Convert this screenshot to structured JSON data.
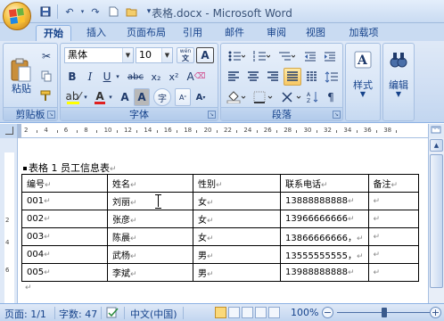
{
  "window": {
    "title": "表格.docx - Microsoft Word"
  },
  "quick_access": [
    {
      "name": "save-icon",
      "glyph": "▣"
    },
    {
      "name": "undo-icon",
      "glyph": "↶"
    },
    {
      "name": "redo-icon",
      "glyph": "↷"
    },
    {
      "name": "new-doc-icon",
      "glyph": "▯"
    },
    {
      "name": "open-folder-icon",
      "glyph": "▰"
    },
    {
      "name": "customize-qat-icon",
      "glyph": "▾"
    }
  ],
  "tabs": [
    "开始",
    "插入",
    "页面布局",
    "引用",
    "邮件",
    "审阅",
    "视图",
    "加载项"
  ],
  "ribbon": {
    "clipboard": {
      "label": "剪贴板",
      "paste": "粘贴"
    },
    "font": {
      "label": "字体",
      "font_name": "黑体",
      "font_size": "10",
      "bold": "B",
      "italic": "I",
      "underline": "U",
      "strike": "abc",
      "subscript": "x₂",
      "superscript": "x²",
      "grow": "A",
      "shrink": "A",
      "char_border": "A",
      "pinyin": "wén",
      "clear_format": "A",
      "char_shading": "A",
      "enclose": "字"
    },
    "paragraph": {
      "label": "段落"
    },
    "styles": {
      "label": "样式"
    },
    "editing": {
      "label": "编辑"
    }
  },
  "ruler": {
    "numbers": [
      "2",
      "4",
      "6",
      "8",
      "10",
      "12",
      "14",
      "16",
      "18",
      "20",
      "22",
      "24",
      "26",
      "28",
      "30",
      "32",
      "34",
      "36",
      "38"
    ]
  },
  "vruler": {
    "numbers": [
      "2",
      "4",
      "6"
    ]
  },
  "document": {
    "caption": "表格 1 员工信息表",
    "paragraph_mark": "↵",
    "table": [
      [
        "编号",
        "姓名",
        "性别",
        "联系电话",
        "备注"
      ],
      [
        "001",
        "刘丽",
        "女",
        "13888888888",
        ""
      ],
      [
        "002",
        "张彦",
        "女",
        "13966666666",
        ""
      ],
      [
        "003",
        "陈晨",
        "女",
        "13866666666，",
        ""
      ],
      [
        "004",
        "武杨",
        "男",
        "13555555555，",
        ""
      ],
      [
        "005",
        "李斌",
        "男",
        "13988888888",
        ""
      ]
    ]
  },
  "status": {
    "page": "页面: 1/1",
    "words": "字数: 47",
    "language": "中文(中国)",
    "zoom": "100%",
    "zoom_minus": "−",
    "zoom_plus": "+"
  }
}
